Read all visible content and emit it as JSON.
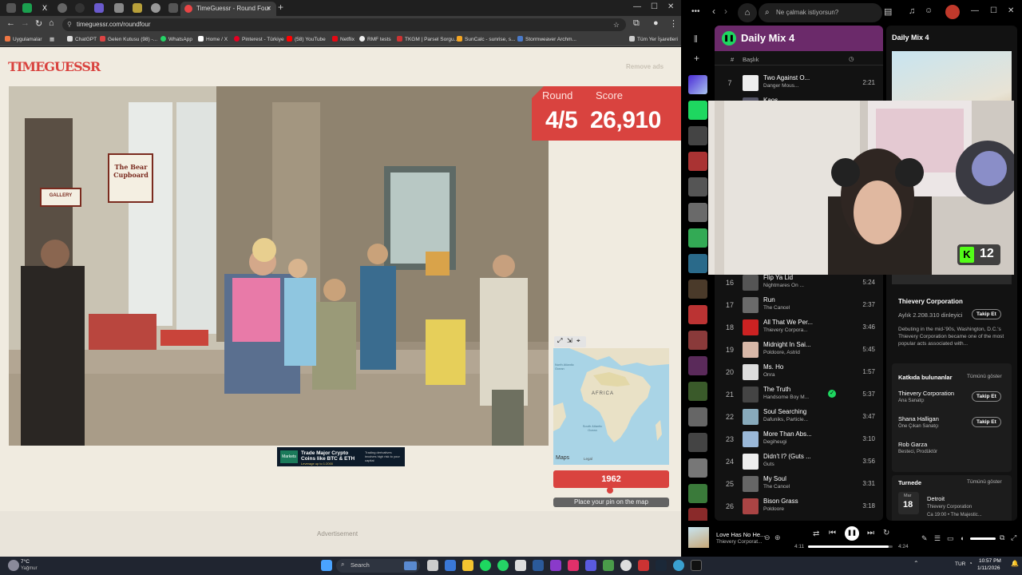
{
  "browser": {
    "active_tab_title": "TimeGuessr - Round Four",
    "url": "timeguessr.com/roundfour",
    "bookmarks": [
      "Uygulamalar",
      "ChatGPT",
      "Gelen Kutusu (98) -...",
      "WhatsApp",
      "Home / X",
      "Pinterest - Türkiye",
      "(58) YouTube",
      "Netflix",
      "RMF tests",
      "TKGM | Parsel Sorgu...",
      "SunCalc - sunrise, s...",
      "Stormweaver Archm...",
      "Tüm Yer İşaretleri"
    ]
  },
  "game": {
    "logo": "TIMEGUESSR",
    "remove_ads": "Remove ads",
    "round_label": "Round",
    "score_label": "Score",
    "round_value": "4/5",
    "score_value": "26,910",
    "shop_sign": "The Bear Cupboard",
    "gallery_sign": "GALLERY",
    "ad_banner": {
      "brand": "Markets",
      "headline": "Trade Major Crypto Coins like BTC & ETH",
      "subline": "Leverage up to 1:2000",
      "disclaimer": "Trading derivatives involves high risk to your capital"
    },
    "map": {
      "label_africa": "AFRICA",
      "label_ocean": "South Atlantic Ocean",
      "label_north": "North Atlantic Ocean",
      "attribution": "Maps",
      "legal": "Legal"
    },
    "year": "1962",
    "year_slider_value": 0.49,
    "place_pin": "Place your pin on the map",
    "advertisement": "Advertisement"
  },
  "spotify": {
    "search_placeholder": "Ne çalmak istiyorsun?",
    "playlist_title": "Daily Mix 4",
    "col_title": "Başlık",
    "col_hash": "#",
    "tracks_top": [
      {
        "num": "7",
        "title": "Two Against O...",
        "artist": "Danger Mous...",
        "duration": "2:21"
      },
      {
        "num": "8",
        "title": "Kaos",
        "artist": "",
        "duration": ""
      }
    ],
    "tracks": [
      {
        "num": "16",
        "title": "Flip Ya Lid",
        "artist": "Nightmares On ...",
        "duration": "5:24"
      },
      {
        "num": "17",
        "title": "Run",
        "artist": "The Cancel",
        "duration": "2:37"
      },
      {
        "num": "18",
        "title": "All That We Per...",
        "artist": "Thievery Corpora...",
        "duration": "3:46"
      },
      {
        "num": "19",
        "title": "Midnight In Sai...",
        "artist": "Poldoore, Astrid",
        "duration": "5:45"
      },
      {
        "num": "20",
        "title": "Ms. Ho",
        "artist": "Onra",
        "duration": "1:57"
      },
      {
        "num": "21",
        "title": "The Truth",
        "artist": "Handsome Boy M...",
        "duration": "5:37"
      },
      {
        "num": "22",
        "title": "Soul Searching",
        "artist": "Dafuniks, Particle...",
        "duration": "3:47"
      },
      {
        "num": "23",
        "title": "More Than Abs...",
        "artist": "Degiheugi",
        "duration": "3:10"
      },
      {
        "num": "24",
        "title": "Didn't I? (Guts ...",
        "artist": "Guts",
        "duration": "3:56"
      },
      {
        "num": "25",
        "title": "My Soul",
        "artist": "The Cancel",
        "duration": "3:31"
      },
      {
        "num": "26",
        "title": "Bison Grass",
        "artist": "Poldoore",
        "duration": "3:18"
      }
    ],
    "right_title": "Daily Mix 4",
    "artist_name": "Thievery Corporation",
    "monthly_listeners": "Aylık 2.208.310 dinleyici",
    "follow": "Takip Et",
    "bio": "Debuting in the mid-'90s, Washington, D.C.'s Thievery Corporation became one of the most popular acts associated with...",
    "credits_title": "Katkıda bulunanlar",
    "show_all": "Tümünü göster",
    "credits": [
      {
        "name": "Thievery Corporation",
        "role": "Ana Sanatçı"
      },
      {
        "name": "Shana Halligan",
        "role": "Öne Çıkan Sanatçı"
      },
      {
        "name": "Rob Garza",
        "role": "Besteci, Prodüktör"
      }
    ],
    "tour_title": "Turnede",
    "tour": {
      "month": "Mar",
      "day": "18",
      "city": "Detroit",
      "artist": "Thievery Corporation",
      "time": "Ca 19:00 • The Majestic..."
    },
    "now_playing": {
      "title": "Love Has No He...",
      "artist": "Thievery Corporat...",
      "elapsed": "4:11",
      "total": "4:24",
      "progress": 0.95
    },
    "stream_counter": "12"
  },
  "taskbar": {
    "weather_temp": "7°C",
    "weather_desc": "Yağmur",
    "search": "Search",
    "lang": "TUR",
    "time": "10:57 PM",
    "date": "1/11/2026"
  },
  "colors": {
    "accent": "#d9433f",
    "spotify_green": "#1ed760",
    "page_bg": "#f0ebe0"
  }
}
